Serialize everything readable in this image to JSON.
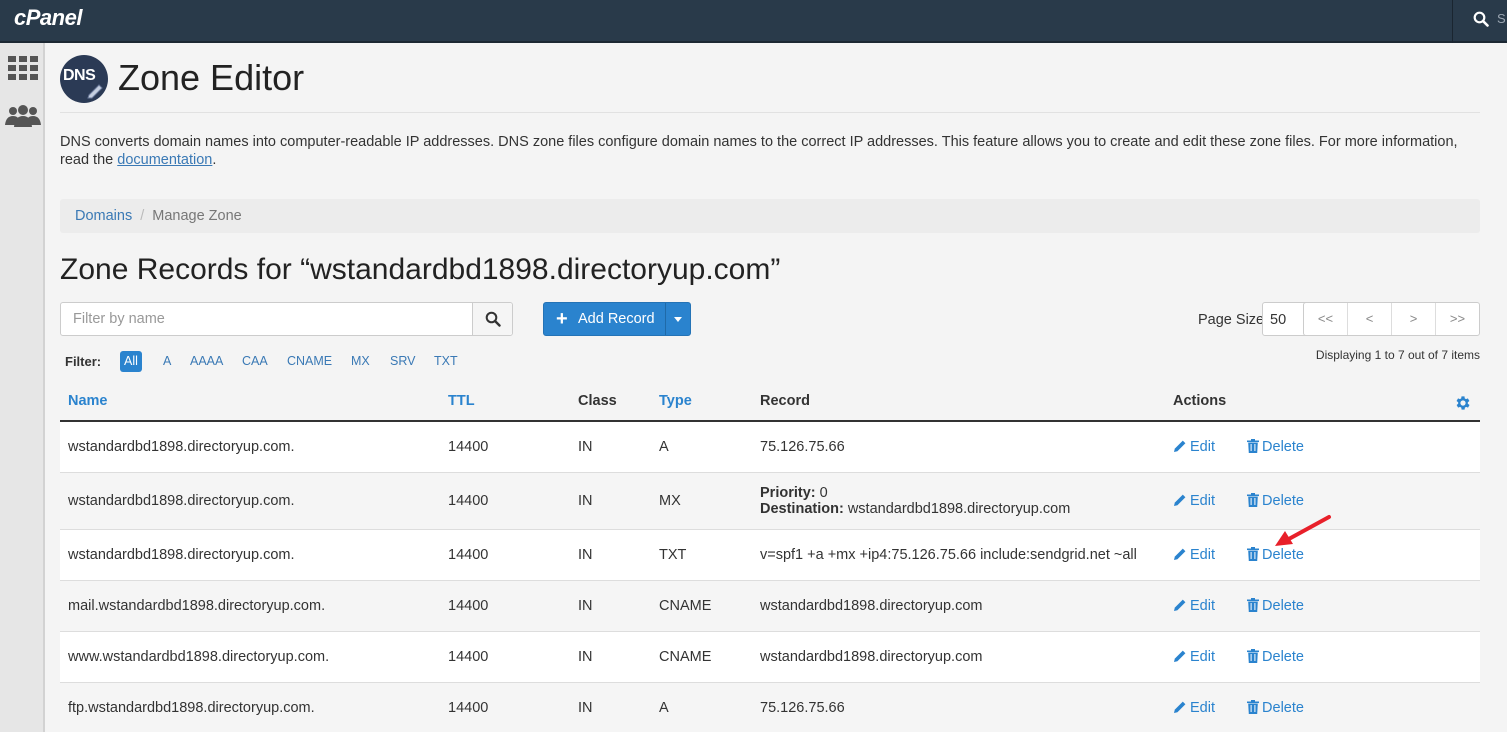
{
  "app": {
    "logo": "cPanel",
    "search_letter": "S"
  },
  "page": {
    "title": "Zone Editor",
    "badge": "DNS",
    "description": "DNS converts domain names into computer-readable IP addresses. DNS zone files configure domain names to the correct IP addresses. This feature allows you to create and edit these zone files. For more information, read the",
    "doc_link": "documentation",
    "description_end": "."
  },
  "breadcrumb": {
    "link": "Domains",
    "current": "Manage Zone"
  },
  "zone": {
    "heading": "Zone Records for “wstandardbd1898.directoryup.com”"
  },
  "toolbar": {
    "filter_placeholder": "Filter by name",
    "add_record": "Add Record",
    "page_size_label": "Page Size",
    "page_size": "50",
    "pager": [
      "<<",
      "<",
      ">",
      ">>"
    ],
    "displaying": "Displaying 1 to 7 out of 7 items"
  },
  "filters": {
    "label": "Filter:",
    "options": [
      "All",
      "A",
      "AAAA",
      "CAA",
      "CNAME",
      "MX",
      "SRV",
      "TXT"
    ],
    "active": "All"
  },
  "table": {
    "columns": [
      "Name",
      "TTL",
      "Class",
      "Type",
      "Record",
      "Actions"
    ],
    "edit_label": "Edit",
    "delete_label": "Delete",
    "priority_label": "Priority:",
    "destination_label": "Destination:",
    "rows": [
      {
        "name": "wstandardbd1898.directoryup.com.",
        "ttl": "14400",
        "class": "IN",
        "type": "A",
        "record": "75.126.75.66"
      },
      {
        "name": "wstandardbd1898.directoryup.com.",
        "ttl": "14400",
        "class": "IN",
        "type": "MX",
        "priority": "0",
        "destination": "wstandardbd1898.directoryup.com"
      },
      {
        "name": "wstandardbd1898.directoryup.com.",
        "ttl": "14400",
        "class": "IN",
        "type": "TXT",
        "record": "v=spf1 +a +mx +ip4:75.126.75.66 include:sendgrid.net ~all"
      },
      {
        "name": "mail.wstandardbd1898.directoryup.com.",
        "ttl": "14400",
        "class": "IN",
        "type": "CNAME",
        "record": "wstandardbd1898.directoryup.com"
      },
      {
        "name": "www.wstandardbd1898.directoryup.com.",
        "ttl": "14400",
        "class": "IN",
        "type": "CNAME",
        "record": "wstandardbd1898.directoryup.com"
      },
      {
        "name": "ftp.wstandardbd1898.directoryup.com.",
        "ttl": "14400",
        "class": "IN",
        "type": "A",
        "record": "75.126.75.66"
      }
    ]
  },
  "colors": {
    "topbar": "#293a4a",
    "accent": "#2a83ce",
    "annotation": "#e8202a"
  }
}
